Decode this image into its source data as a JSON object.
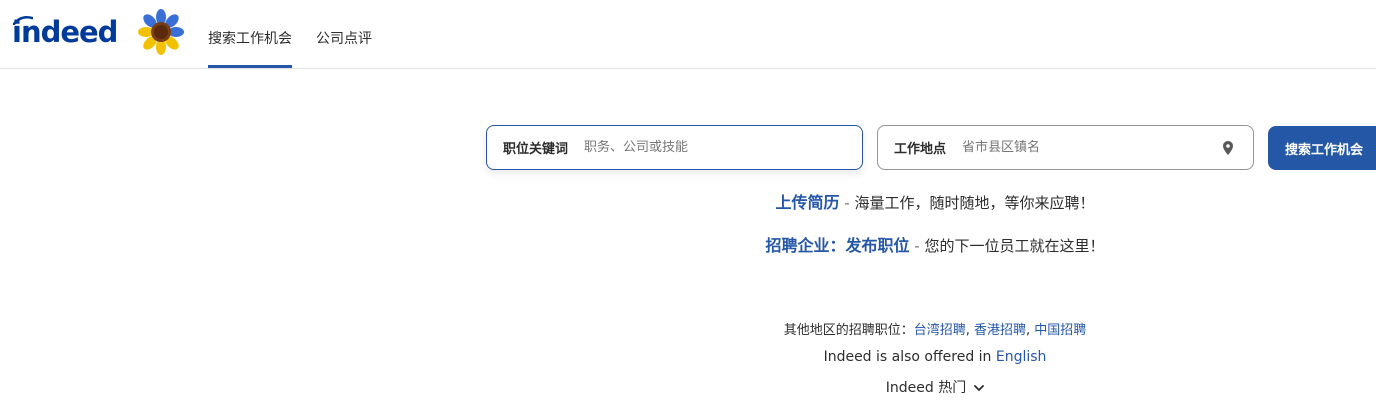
{
  "header": {
    "logo_text": "indeed",
    "logo_icon": "indeed-logo",
    "sunflower_icon": "sunflower-icon",
    "nav": [
      {
        "label": "搜索工作机会",
        "active": true
      },
      {
        "label": "公司点评",
        "active": false
      }
    ]
  },
  "search": {
    "what_label": "职位关键词",
    "what_placeholder": "职务、公司或技能",
    "where_label": "工作地点",
    "where_placeholder": "省市县区镇名",
    "location_icon": "location-pin-icon",
    "button_label": "搜索工作机会"
  },
  "promo": {
    "upload_link": "上传简历",
    "upload_sep": " - ",
    "upload_text": "海量工作，随时随地，等你来应聘！",
    "employer_link": "招聘企业：发布职位",
    "employer_sep": " - ",
    "employer_text": "您的下一位员工就在这里！"
  },
  "footer": {
    "regions_prefix": "其他地区的招聘职位：",
    "regions": [
      "台湾招聘",
      "香港招聘",
      "中国招聘"
    ],
    "region_sep": ", ",
    "language_prefix": "Indeed is also offered in ",
    "language_link": "English",
    "popular_label": "Indeed 热门",
    "chevron_icon": "chevron-down-icon"
  },
  "colors": {
    "brand_blue": "#2557a7",
    "logo_blue": "#003a9b",
    "text": "#2d2d2d",
    "placeholder": "#767676"
  }
}
